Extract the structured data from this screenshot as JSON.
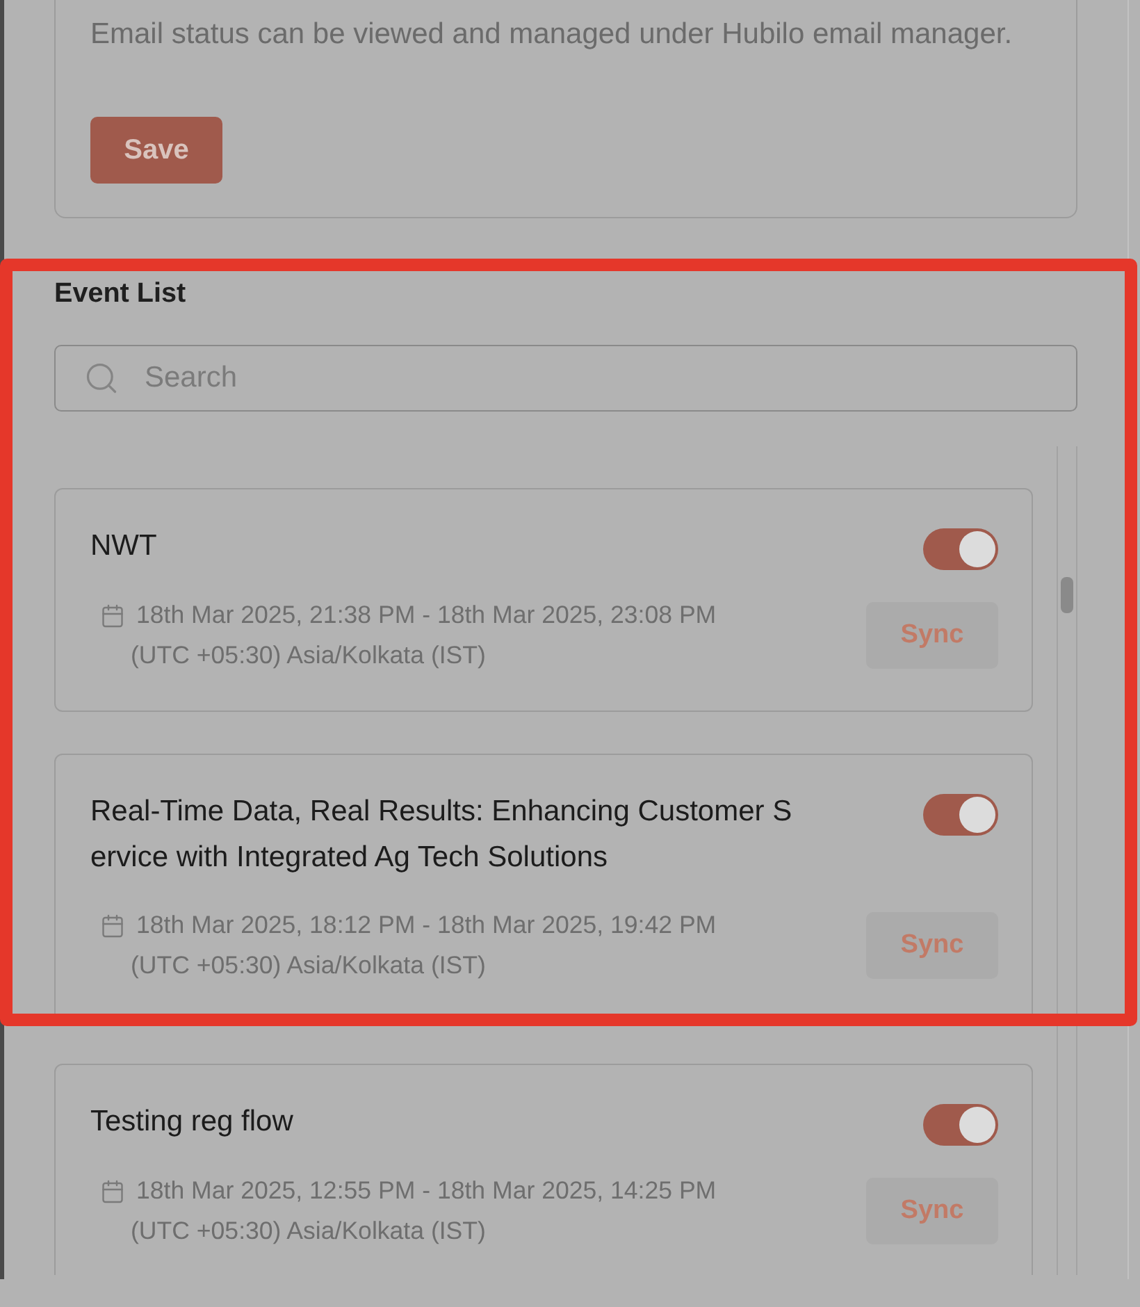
{
  "email_settings": {
    "note": "Email status can be viewed and managed under Hubilo email manager.",
    "save_button": "Save"
  },
  "event_list": {
    "highlighted": true,
    "title": "Event List",
    "search": {
      "placeholder": "Search"
    },
    "events": [
      {
        "title": "NWT",
        "on": true,
        "date_range": "18th Mar 2025, 21:38 PM - 18th Mar 2025, 23:08 PM",
        "timezone": "(UTC +05:30) Asia/Kolkata (IST)",
        "sync_button": "Sync"
      },
      {
        "title": "Real-Time Data, Real Results: Enhancing Customer Service with Integrated Ag Tech Solutions",
        "on": true,
        "date_range": "18th Mar 2025, 18:12 PM - 18th Mar 2025, 19:42 PM",
        "timezone": "(UTC +05:30) Asia/Kolkata (IST)",
        "sync_button": "Sync"
      },
      {
        "title": "Testing reg flow",
        "on": true,
        "date_range": "18th Mar 2025, 12:55 PM - 18th Mar 2025, 14:25 PM",
        "timezone": "(UTC +05:30) Asia/Kolkata (IST)",
        "sync_button": "Sync"
      }
    ]
  }
}
